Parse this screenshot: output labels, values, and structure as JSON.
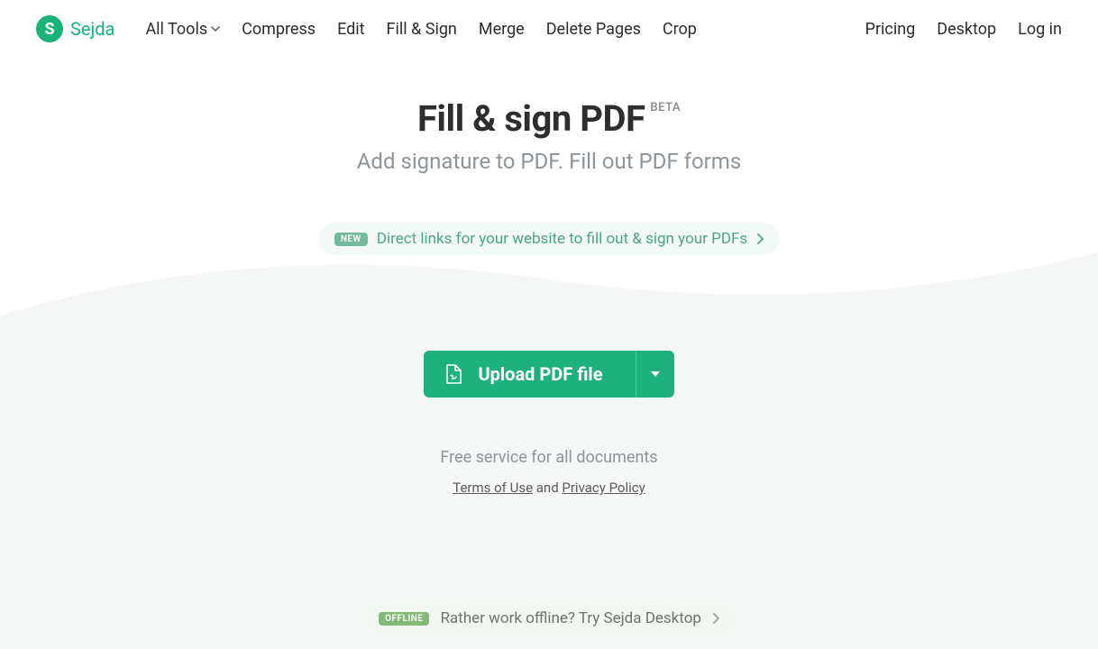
{
  "brand": {
    "name": "Sejda",
    "initial": "S"
  },
  "nav": {
    "left": {
      "all_tools": "All Tools",
      "compress": "Compress",
      "edit": "Edit",
      "fill_sign": "Fill & Sign",
      "merge": "Merge",
      "delete_pages": "Delete Pages",
      "crop": "Crop"
    },
    "right": {
      "pricing": "Pricing",
      "desktop": "Desktop",
      "login": "Log in"
    }
  },
  "hero": {
    "title": "Fill & sign PDF",
    "beta": "BETA",
    "subtitle": "Add signature to PDF. Fill out PDF forms"
  },
  "promo": {
    "badge": "NEW",
    "text": "Direct links for your website to fill out & sign your PDFs"
  },
  "upload": {
    "label": "Upload PDF file"
  },
  "free_text": "Free service for all documents",
  "terms": {
    "tos": "Terms of Use",
    "and": " and ",
    "privacy": "Privacy Policy"
  },
  "offline": {
    "badge": "OFFLINE",
    "text": "Rather work offline? Try Sejda Desktop"
  }
}
